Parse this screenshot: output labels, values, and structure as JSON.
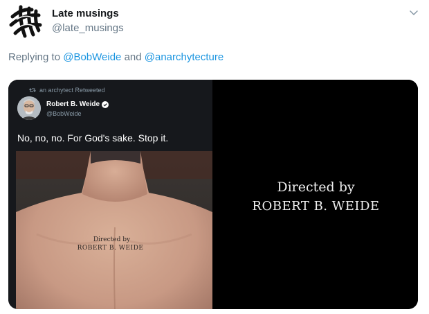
{
  "tweet": {
    "display_name": "Late musings",
    "handle": "@late_musings",
    "reply_prefix": "Replying to",
    "reply_conjunction": "and",
    "mentions": [
      "@BobWeide",
      "@anarchytecture"
    ]
  },
  "embedded_tweet": {
    "retweet_label": "an archytect Retweeted",
    "name": "Robert B. Weide",
    "handle": "@BobWeide",
    "text": "No, no, no. For God's sake. Stop it.",
    "tattoo_line1": "Directed by",
    "tattoo_line2": "ROBERT B. WEIDE"
  },
  "credit_card": {
    "line1": "Directed by",
    "line2": "ROBERT B. WEIDE"
  },
  "icons": {
    "caret": "chevron-down-icon",
    "retweet": "retweet-icon",
    "verified": "verified-badge-icon"
  },
  "colors": {
    "link": "#1b95e0",
    "secondary_text": "#657786",
    "verified": "#ffffff"
  }
}
